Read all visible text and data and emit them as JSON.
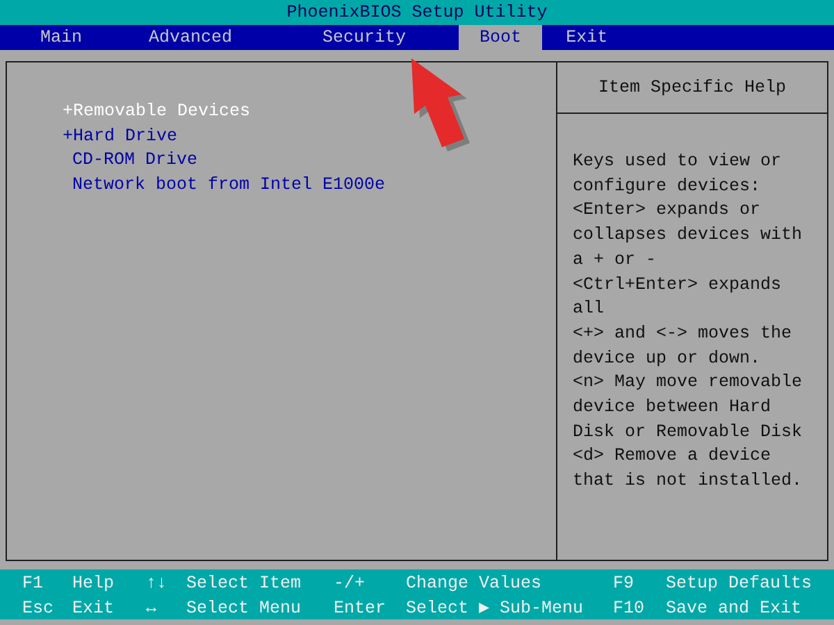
{
  "window": {
    "title": "PhoenixBIOS Setup Utility"
  },
  "tabs": [
    {
      "label": "Main",
      "selected": false
    },
    {
      "label": "Advanced",
      "selected": false
    },
    {
      "label": "Security",
      "selected": false
    },
    {
      "label": "Boot",
      "selected": true
    },
    {
      "label": "Exit",
      "selected": false
    }
  ],
  "boot_order": [
    {
      "label": "+Removable Devices",
      "selected": true
    },
    {
      "label": "+Hard Drive",
      "selected": false
    },
    {
      "label": "CD-ROM Drive",
      "selected": false
    },
    {
      "label": "Network boot from Intel E1000e",
      "selected": false
    }
  ],
  "help": {
    "title": "Item Specific Help",
    "lines": [
      "Keys used to view or",
      "configure devices:",
      "<Enter> expands or",
      "collapses devices with",
      "a + or -",
      "<Ctrl+Enter> expands",
      "all",
      "<+> and <-> moves the",
      "device up or down.",
      "<n> May move removable",
      "device between Hard",
      "Disk or Removable Disk",
      "<d> Remove a device",
      "that is not installed."
    ]
  },
  "annotation": {
    "kind": "arrow"
  },
  "footer": [
    [
      {
        "key": "F1",
        "action": "Help"
      },
      {
        "key": "↑↓",
        "action": "Select Item"
      },
      {
        "key": "-/+",
        "action": "Change Values"
      },
      {
        "key": "F9",
        "action": "Setup Defaults"
      }
    ],
    [
      {
        "key": "Esc",
        "action": "Exit"
      },
      {
        "key": "↔",
        "action": "Select Menu"
      },
      {
        "key": "Enter",
        "action": "Select ▶ Sub-Menu"
      },
      {
        "key": "F10",
        "action": "Save and Exit"
      }
    ]
  ]
}
